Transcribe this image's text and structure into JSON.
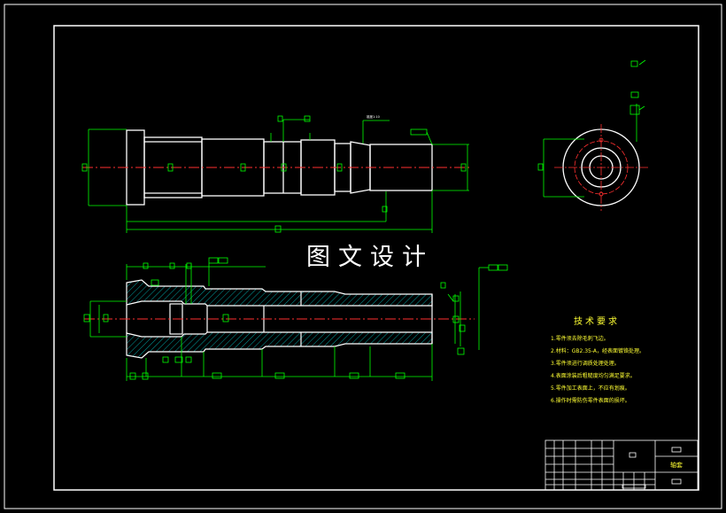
{
  "watermark": "图文设计",
  "technical_requirements": {
    "title": "技术要求",
    "items": [
      "1.零件须去除毛刺飞边。",
      "2.材料：GB2.35-A，经表面镀铬处理。",
      "3.零件须进行调质处理处理。",
      "4.表面涂装后粗糙度均匀满足要求。",
      "5.零件加工表面上，不应有划痕。",
      "6.操作时需防伤零件表面的损坏。"
    ]
  },
  "title_block": {
    "part_name": "轴套"
  },
  "labels": {
    "top_dim_note": "锥度1:10"
  },
  "colors": {
    "outline": "#ffffff",
    "dimension": "#00ff00",
    "centerline": "#ff3030",
    "hatch": "#00c8c8",
    "text": "#ffff33"
  }
}
